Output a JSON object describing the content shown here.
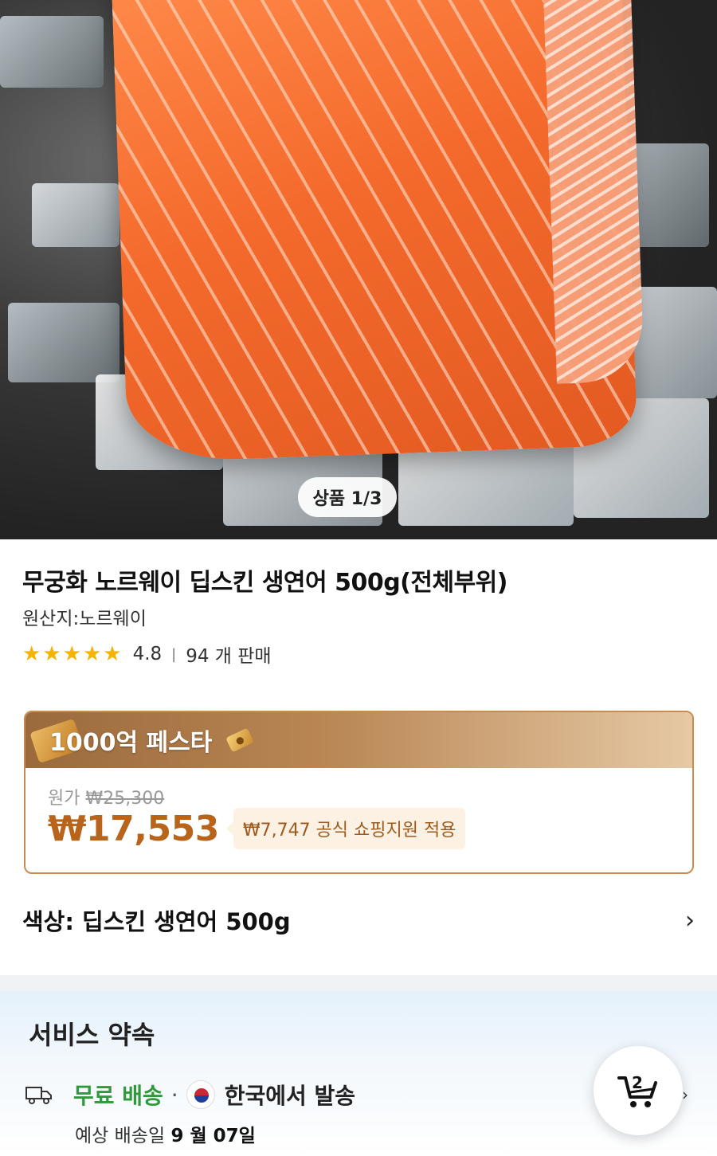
{
  "hero": {
    "image_alt": "",
    "counter": "상품 1/3"
  },
  "product": {
    "title": "무궁화 노르웨이 딥스킨 생연어 500g(전체부위)",
    "origin": "원산지:노르웨이",
    "rating": "4.8",
    "stars": 5,
    "sold": "94 개 판매"
  },
  "promo": {
    "title": "1000억 페스타",
    "original_label": "원가",
    "original_price": "₩25,300",
    "price": "₩17,553",
    "subsidy": "₩7,747 공식 쇼핑지원 적용"
  },
  "option": {
    "label": "색상: 딥스킨 생연어 500g"
  },
  "service": {
    "title": "서비스 약속",
    "free_shipping": "무료 배송",
    "separator": "·",
    "ship_from": "한국에서 발송",
    "eta_label": "예상 배송일",
    "eta_date": "9 월 07일"
  },
  "cart": {
    "count": "2"
  },
  "colors": {
    "accent_price": "#b8651b",
    "free_shipping": "#2e9a3a",
    "star": "#f5b400"
  }
}
